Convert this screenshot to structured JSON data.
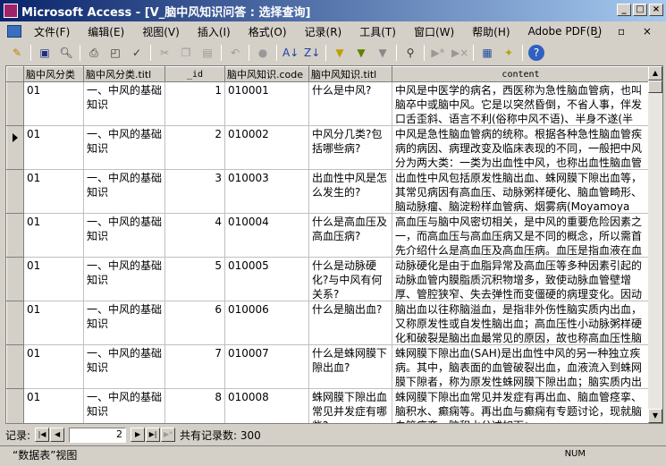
{
  "window": {
    "title": "Microsoft Access - [V_脑中风知识问答 : 选择查询]"
  },
  "menu": [
    "文件(F)",
    "编辑(E)",
    "视图(V)",
    "插入(I)",
    "格式(O)",
    "记录(R)",
    "工具(T)",
    "窗口(W)",
    "帮助(H)",
    "Adobe PDF(B)"
  ],
  "columns": [
    "脑中风分类",
    "脑中风分类.titl",
    "_id",
    "脑中风知识.code",
    "脑中风知识.titl",
    "content"
  ],
  "rows": [
    {
      "cat": "01",
      "cat_title": "一、中风的基础知识",
      "id": "1",
      "code": "010001",
      "title": "什么是中风?",
      "content": "中风是中医学的病名，西医称为急性脑血管病，也叫脑卒中或脑中风。它是以突然昏倒，不省人事，伴发口舌歪斜、语言不利(俗称中风不语)、半身不遂(半"
    },
    {
      "cat": "01",
      "cat_title": "一、中风的基础知识",
      "id": "2",
      "code": "010002",
      "title": "中风分几类?包括哪些病?",
      "content": "中风是急性脑血管病的统称。根据各种急性脑血管疾病的病因、病理改变及临床表现的不同，一般把中风分为两大类：一类为出血性中风，也称出血性脑血管"
    },
    {
      "cat": "01",
      "cat_title": "一、中风的基础知识",
      "id": "3",
      "code": "010003",
      "title": "出血性中风是怎么发生的?",
      "content": "出血性中风包括原发性脑出血、蛛网膜下隙出血等，其常见病因有高血压、动脉粥样硬化、脑血管畸形、脑动脉瘤、脑淀粉样血管病、烟雾病(Moyamoya病，"
    },
    {
      "cat": "01",
      "cat_title": "一、中风的基础知识",
      "id": "4",
      "code": "010004",
      "title": "什么是高血压及高血压病?",
      "content": "高血压与脑中风密切相关，是中风的重要危险因素之一，而高血压与高血压病又是不同的概念，所以需首先介绍什么是高血压及高血压病。血压是指血液在血"
    },
    {
      "cat": "01",
      "cat_title": "一、中风的基础知识",
      "id": "5",
      "code": "010005",
      "title": "什么是动脉硬化?与中风有何关系?",
      "content": "动脉硬化是由于血脂异常及高血压等多种因素引起的动脉血管内膜脂质沉积物增多，致使动脉血管壁增厚、管腔狭窄、失去弹性而变僵硬的病理变化。因动"
    },
    {
      "cat": "01",
      "cat_title": "一、中风的基础知识",
      "id": "6",
      "code": "010006",
      "title": "什么是脑出血?",
      "content": "脑出血以往称脑溢血，是指非外伤性脑实质内出血，又称原发性或自发性脑出血；高血压性小动脉粥样硬化和破裂是脑出血最常见的原因，故也称高血压性脑"
    },
    {
      "cat": "01",
      "cat_title": "一、中风的基础知识",
      "id": "7",
      "code": "010007",
      "title": "什么是蛛网膜下隙出血?",
      "content": "蛛网膜下隙出血(SAH)是出血性中风的另一种独立疾病。其中，脑表面的血管破裂出血，血液流入到蛛网膜下隙者，称为原发性蛛网膜下隙出血；脑实质内出"
    },
    {
      "cat": "01",
      "cat_title": "一、中风的基础知识",
      "id": "8",
      "code": "010008",
      "title": "蛛网膜下隙出血常见并发症有哪些?",
      "content": "蛛网膜下隙出血常见并发症有再出血、脑血管痉挛、脑积水、癫痫等。再出血与癫痫有专题讨论，现就脑血管痉挛、脑积水分述如下："
    }
  ],
  "selected_row": 2,
  "navigator": {
    "label": "记录:",
    "current": "2",
    "total_text": "共有记录数: 300"
  },
  "status": {
    "view": "“数据表”视图",
    "num": "NUM"
  }
}
